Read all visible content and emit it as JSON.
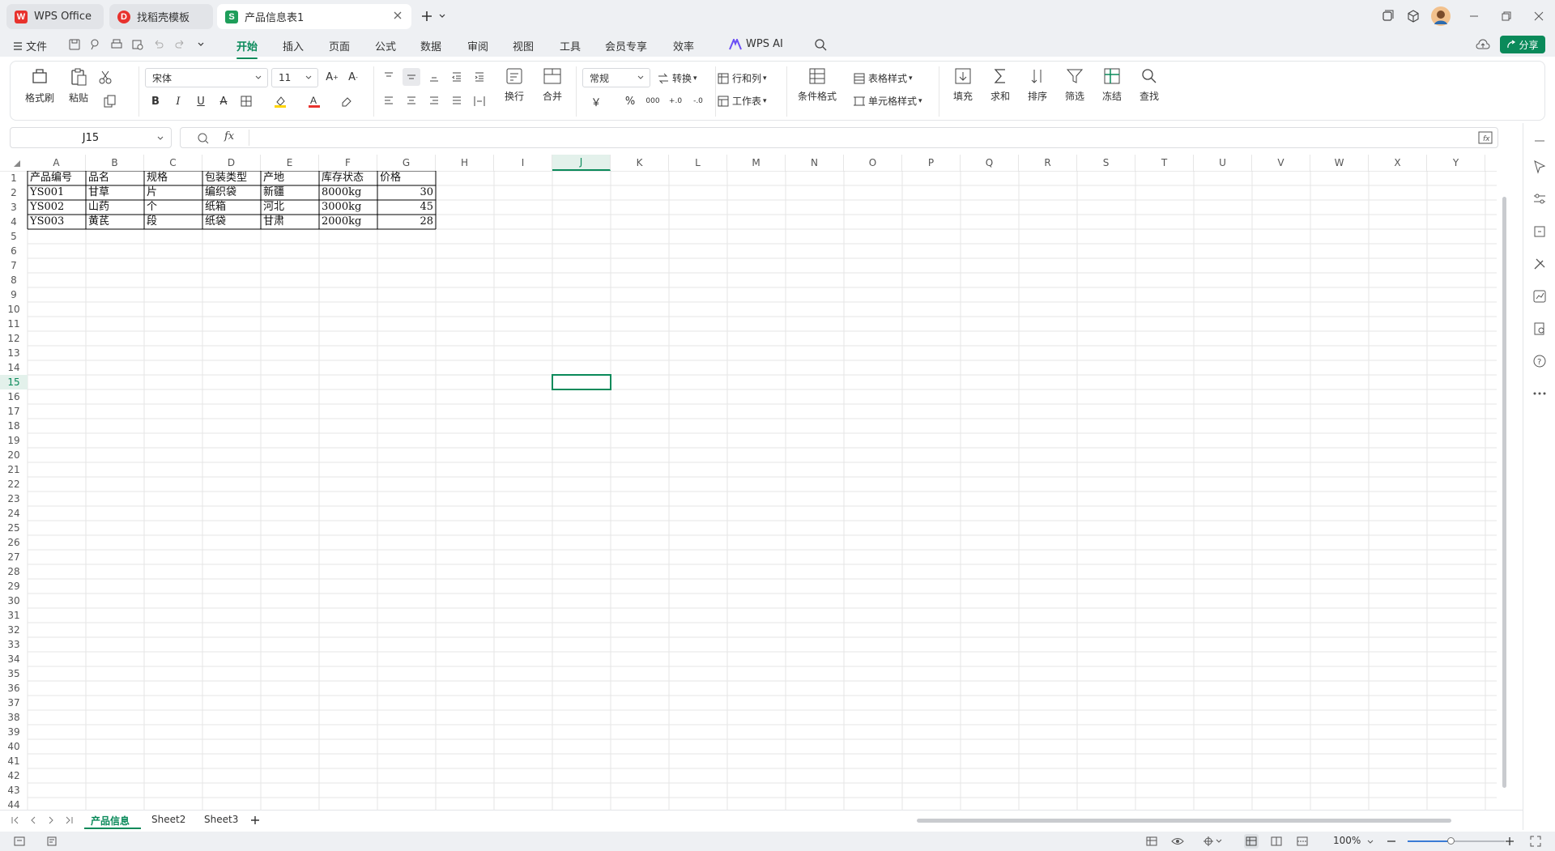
{
  "tabs": [
    {
      "label": "WPS Office",
      "icon": "wps-logo-icon"
    },
    {
      "label": "找稻壳模板",
      "icon": "docer-icon"
    },
    {
      "label": "产品信息表1",
      "icon": "spreadsheet-icon"
    }
  ],
  "menu": {
    "file": "文件",
    "items": [
      "开始",
      "插入",
      "页面",
      "公式",
      "数据",
      "审阅",
      "视图",
      "工具",
      "会员专享",
      "效率"
    ],
    "active": "开始",
    "wps_ai": "WPS AI",
    "share": "分享"
  },
  "ribbon": {
    "format_painter": "格式刷",
    "paste": "粘贴",
    "font_name": "宋体",
    "font_size": "11",
    "wrap": "换行",
    "merge": "合并",
    "number_format": "常规",
    "convert": "转换",
    "rows_cols": "行和列",
    "worksheet": "工作表",
    "cond_format": "条件格式",
    "table_style": "表格样式",
    "cell_style": "单元格样式",
    "fill": "填充",
    "sum": "求和",
    "sort": "排序",
    "filter": "筛选",
    "freeze": "冻结",
    "find": "查找",
    "currency": "￥",
    "percent": "%"
  },
  "formula": {
    "namebox": "J15",
    "fx": "fx",
    "value": ""
  },
  "columns": [
    "A",
    "B",
    "C",
    "D",
    "E",
    "F",
    "G",
    "H",
    "I",
    "J",
    "K",
    "L",
    "M",
    "N",
    "O",
    "P",
    "Q",
    "R",
    "S",
    "T",
    "U",
    "V",
    "W",
    "X",
    "Y"
  ],
  "selected_col": "J",
  "selected_row": 15,
  "row_count": 44,
  "table": {
    "rows": [
      [
        "产品编号",
        "品名",
        "规格",
        "包装类型",
        "产地",
        "库存状态",
        "价格"
      ],
      [
        "YS001",
        "甘草",
        "片",
        "编织袋",
        "新疆",
        "8000kg",
        "30"
      ],
      [
        "YS002",
        "山药",
        "个",
        "纸箱",
        "河北",
        "3000kg",
        "45"
      ],
      [
        "YS003",
        "黄芪",
        "段",
        "纸袋",
        "甘肃",
        "2000kg",
        "28"
      ]
    ]
  },
  "sheets": [
    "产品信息",
    "Sheet2",
    "Sheet3"
  ],
  "active_sheet": "产品信息",
  "status": {
    "zoom": "100%"
  },
  "colors": {
    "accent": "#0a8a5a",
    "wps_red": "#e8322d",
    "sheet_green": "#1e9e5a"
  }
}
